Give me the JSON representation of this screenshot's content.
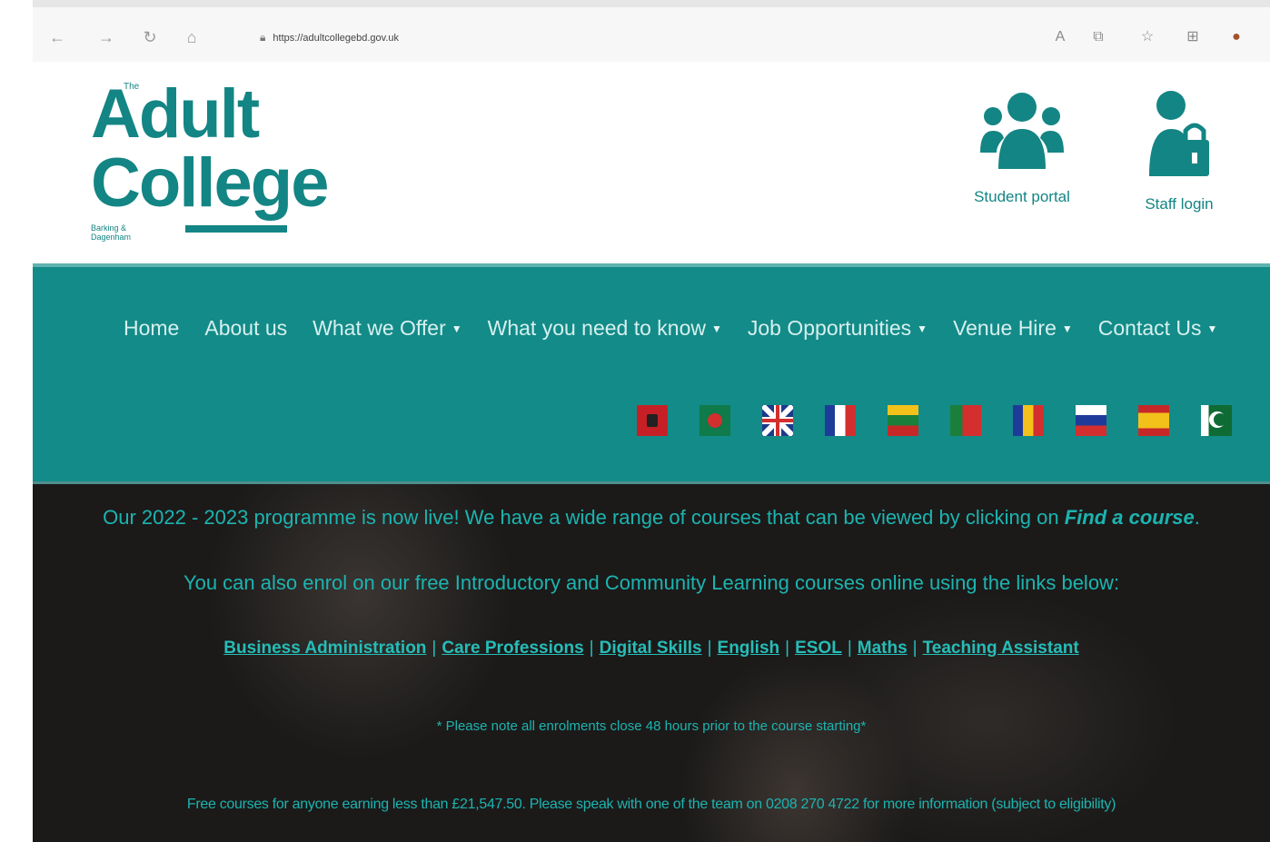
{
  "browser": {
    "url": "https://adultcollegebd.gov.uk"
  },
  "header": {
    "logo": {
      "the": "The",
      "line1": "Adult",
      "line2": "College",
      "sub": "Barking & Dagenham"
    },
    "student_portal": "Student portal",
    "staff_login": "Staff login"
  },
  "nav": {
    "items": [
      {
        "label": "Home",
        "dropdown": false
      },
      {
        "label": "About us",
        "dropdown": false
      },
      {
        "label": "What we Offer",
        "dropdown": true
      },
      {
        "label": "What you need to know",
        "dropdown": true
      },
      {
        "label": "Job Opportunities",
        "dropdown": true
      },
      {
        "label": "Venue Hire",
        "dropdown": true
      },
      {
        "label": "Contact Us",
        "dropdown": true
      }
    ]
  },
  "flags": [
    "albania",
    "bangladesh",
    "united-kingdom",
    "france",
    "lithuania",
    "portugal",
    "romania",
    "russia",
    "spain",
    "pakistan"
  ],
  "hero": {
    "line1_text": "Our 2022 - 2023 programme is now live! We have a wide range of courses that can be viewed by clicking on ",
    "line1_link": "Find a course",
    "line1_end": ".",
    "line2": "You can also enrol on our free Introductory and Community Learning courses online using the links below:",
    "links": [
      "Business Administration",
      "Care Professions",
      "Digital Skills",
      "English",
      "ESOL",
      "Maths",
      "Teaching Assistant"
    ],
    "note": "* Please note all enrolments close 48 hours prior to the course starting*",
    "free_courses": "Free courses for anyone earning less than £21,547.50. Please speak with one of the team on 0208 270 4722 for more information (subject to eligibility)"
  },
  "colors": {
    "brand_teal": "#138584",
    "nav_band": "#138b88",
    "hero_text": "#1cb4b0"
  }
}
